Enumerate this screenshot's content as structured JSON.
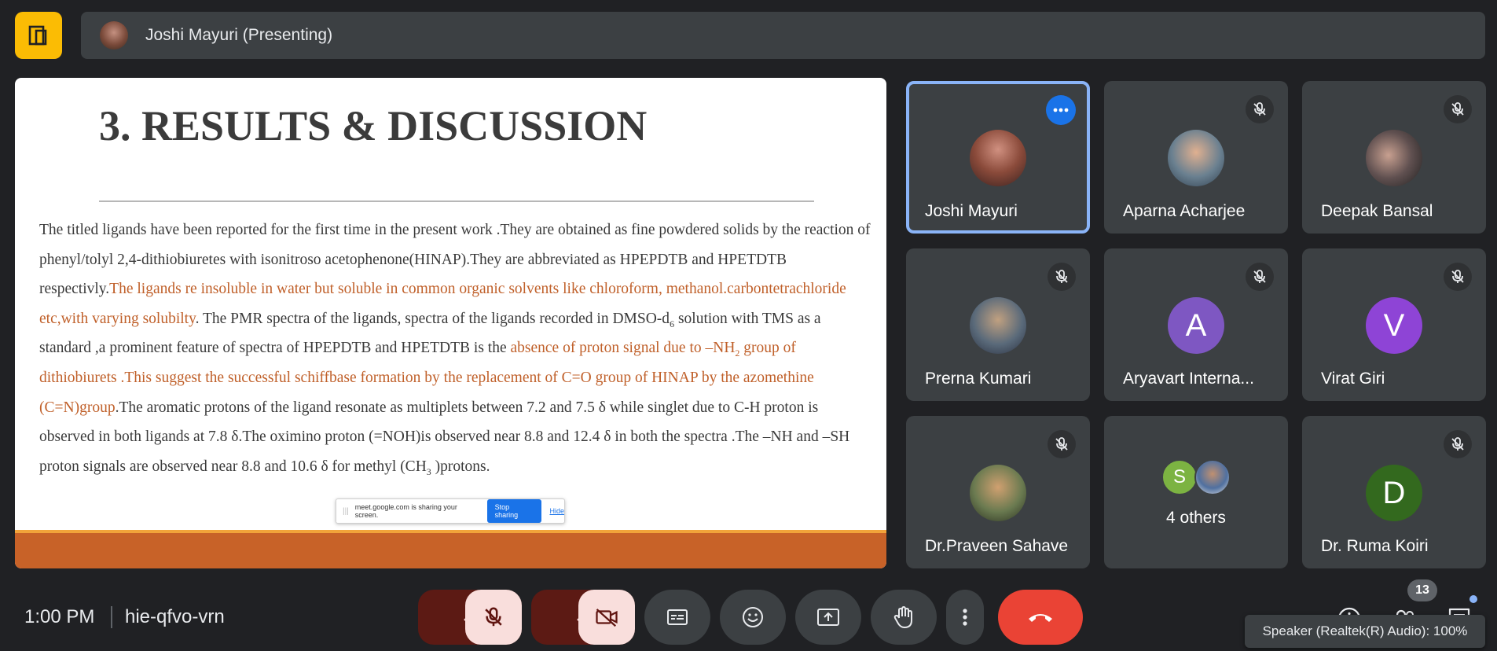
{
  "top_bar": {
    "presenter_label": "Joshi Mayuri (Presenting)"
  },
  "slide": {
    "title": "3. RESULTS & DISCUSSION",
    "p1": "The titled ligands have been reported for the first time in the present work .They are obtained as  fine powdered solids by the reaction of phenyl/tolyl 2,4-dithiobiuretes with isonitroso acetophenone(HINAP).They are abbreviated as HPEPDTB and HPETDTB respectivly.",
    "p1_hl": "The ligands re insoluble in water but soluble in common organic solvents like chloroform, methanol.carbontetrachloride etc,with varying solubilty",
    "p2a": ". The PMR spectra of the ligands, spectra of the ligands recorded in DMSO-d",
    "p2_sub": "6",
    "p2b": " solution with TMS as a standard ,a prominent feature of spectra of HPEPDTB and HPETDTB is the ",
    "hl2a": "absence of proton signal due to –NH",
    "hl2_sub": "2",
    "hl2b": " group of dithiobiurets .This suggest the successful schiffbase formation by the replacement of C=O  group of HINAP by the azomethine (C=N)group",
    "p3": ".The aromatic protons of the ligand resonate as multiplets between 7.2 and 7.5 δ while singlet due to C-H proton is observed in both ligands at 7.8 δ.The oximino proton (=NOH)is observed near 8.8 and 12.4 δ in both the spectra .The –NH and –SH proton signals are observed near 8.8 and 10.6 δ for methyl (CH",
    "p3_sub": "3",
    "p3_end": " )protons."
  },
  "share_bar": {
    "grip": "|||",
    "text": "meet.google.com is sharing your screen.",
    "stop_label": "Stop sharing",
    "hide_label": "Hide"
  },
  "participants": [
    {
      "name": "Joshi Mayuri",
      "active": true
    },
    {
      "name": "Aparna Acharjee"
    },
    {
      "name": "Deepak Bansal"
    },
    {
      "name": "Prerna Kumari"
    },
    {
      "name": "Aryavart Interna...",
      "initial": "A",
      "color": "#7e57c2"
    },
    {
      "name": "Virat Giri",
      "initial": "V",
      "color": "#8e44d6"
    },
    {
      "name": "Dr.Praveen Sahave"
    },
    {
      "name": "4 others",
      "initial": "S",
      "color": "#7cb342"
    },
    {
      "name": "Dr. Ruma Koiri",
      "initial": "D",
      "color": "#33691e"
    }
  ],
  "bottom_bar": {
    "time": "1:00 PM",
    "meeting_code": "hie-qfvo-vrn",
    "people_count": "13",
    "tooltip": "Speaker (Realtek(R) Audio): 100%"
  },
  "colors": {
    "background": "#202124",
    "tile": "#3c4043",
    "active_border": "#8ab4f8",
    "end_call": "#ea4335",
    "accent_blue": "#1a73e8",
    "logo": "#fbbc04",
    "slide_highlight": "#c0602a",
    "slide_band": "#c86228"
  }
}
